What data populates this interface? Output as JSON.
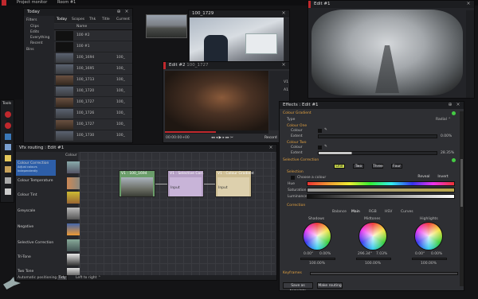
{
  "topbar": {
    "title": "Project monitor",
    "room": "Room #1"
  },
  "bin": {
    "title": "Today",
    "sidebar": [
      "Filters",
      "Clips",
      "Edits",
      "Everything",
      "Recent",
      "Bins"
    ],
    "tabs": [
      "Today",
      "Scopes",
      "Thk",
      "Title",
      "Current"
    ],
    "columns": [
      "",
      "Name"
    ],
    "rows": [
      {
        "name": "100 #2",
        "tag": ""
      },
      {
        "name": "100 #1",
        "tag": ""
      },
      {
        "name": "100_1694",
        "tag": "100_"
      },
      {
        "name": "100_1695",
        "tag": "100_"
      },
      {
        "name": "100_1713",
        "tag": "100_"
      },
      {
        "name": "100_1720",
        "tag": "100_"
      },
      {
        "name": "100_1727",
        "tag": "100_"
      },
      {
        "name": "100_1726",
        "tag": "100_"
      },
      {
        "name": "100_1727",
        "tag": "100_"
      },
      {
        "name": "100_1730",
        "tag": "100_"
      },
      {
        "name": "100_1733",
        "tag": "100_"
      }
    ]
  },
  "viewer_clip": {
    "title": "100_1729"
  },
  "viewer_edit2": {
    "title": "Edit #2",
    "sub": "100_1727",
    "timecode": "00:00:00+00",
    "record": "Record",
    "track_v1": "V1",
    "track_a1": "A1"
  },
  "viewer_edit1": {
    "title": "Edit #1"
  },
  "tools": {
    "title": "Tools"
  },
  "routing": {
    "title": "Vfx routing : Edit #1",
    "list_header": "Colour",
    "effects": [
      {
        "name": "Colour Correction",
        "sub": "Adjust colours",
        "sub2": "Independently"
      },
      {
        "name": "Colour Temperature",
        "sub": ""
      },
      {
        "name": "Colour Tint",
        "sub": ""
      },
      {
        "name": "Greyscale",
        "sub": ""
      },
      {
        "name": "Negative",
        "sub": ""
      },
      {
        "name": "Selective Correction",
        "sub": ""
      },
      {
        "name": "Tri-Tone",
        "sub": ""
      },
      {
        "name": "Two Tone",
        "sub": ""
      }
    ],
    "nodes": [
      {
        "title": "V1 : 100_1694"
      },
      {
        "title": "V1 : Selective Corr.",
        "port": "Input"
      },
      {
        "title": "V1 : Colour Gradient",
        "port": "Input"
      }
    ],
    "footer_auto": "Automatic positioning",
    "footer_tidy": "Tidy",
    "footer_dir": "Left to right ⌃"
  },
  "effects": {
    "title": "Effects : Edit #1",
    "sec_gradient": "Colour Gradient",
    "type_label": "Type",
    "type_value": "Radial ⌃",
    "colour_one": "Colour One",
    "colour_one_colour": "Colour",
    "colour_one_extent": "Extent",
    "colour_one_value": "0.00%",
    "colour_two": "Colour Two",
    "colour_two_colour": "Colour",
    "colour_two_extent": "Extent",
    "colour_two_value": "28.35%",
    "sec_selective": "Selective Correction",
    "sel_tabs": [
      "One",
      "Two",
      "Three",
      "Four"
    ],
    "sel_header": "Selection",
    "choose_colour": "Choose a colour",
    "reveal": "Reveal",
    "invert": "Invert",
    "hue": "Hue",
    "saturation": "Saturation",
    "luminance": "Luminance",
    "corr_header": "Correction",
    "corr_tabs": [
      "Balance",
      "Main",
      "RGB",
      "HSV",
      "Curves"
    ],
    "wheels": [
      {
        "label": "Shadows",
        "v1": "0.00°",
        "v2": "0.00%",
        "level": "100.00%"
      },
      {
        "label": "Midtones",
        "v1": "296.34°",
        "v2": "7.03%",
        "level": "100.00%"
      },
      {
        "label": "Highlights",
        "v1": "0.00°",
        "v2": "0.00%",
        "level": "100.00%"
      }
    ],
    "keyframes": "Keyframes",
    "save_template": "Save as template",
    "make_routing": "Make routing"
  },
  "colors": {
    "accent_red": "#c0282d",
    "accent_blue": "#2d5ea8",
    "node_green": "#6a9d6a"
  }
}
